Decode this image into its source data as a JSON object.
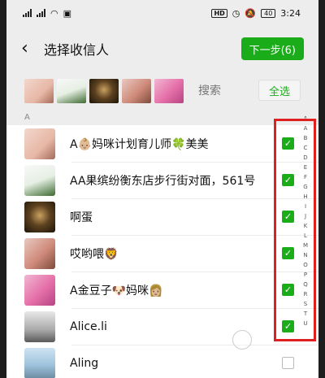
{
  "status": {
    "battery": "40",
    "time": "3:24",
    "hd": "HD"
  },
  "header": {
    "back_label": "‹",
    "title": "选择收信人",
    "next_label": "下一步(6)"
  },
  "selected_bar": {
    "search_placeholder": "搜索",
    "select_all_label": "全选"
  },
  "section": {
    "letter": "A"
  },
  "contacts": [
    {
      "name": "A👶🏼妈咪计划育儿师🍀美美",
      "checked": true
    },
    {
      "name": "AA果缤纷衡东店步行街对面，561号",
      "checked": true
    },
    {
      "name": "啊蛋",
      "checked": true
    },
    {
      "name": "哎哟喂🦁",
      "checked": true
    },
    {
      "name": "A金豆子🐶妈咪👩🏼",
      "checked": true
    },
    {
      "name": "Alice.li",
      "checked": true
    },
    {
      "name": "Aling",
      "checked": false
    }
  ],
  "index_letters": [
    "↑",
    "A",
    "B",
    "C",
    "D",
    "E",
    "F",
    "G",
    "H",
    "I",
    "J",
    "K",
    "L",
    "M",
    "N",
    "O",
    "P",
    "Q",
    "R",
    "S",
    "T",
    "U"
  ],
  "colors": {
    "accent": "#1aad19",
    "highlight": "#e02020"
  }
}
